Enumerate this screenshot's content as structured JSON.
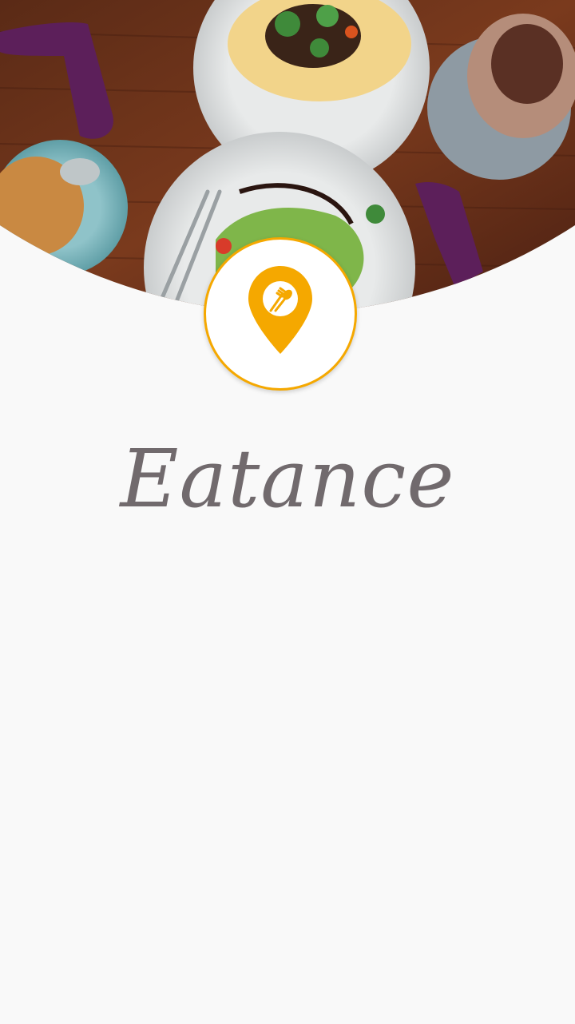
{
  "app": {
    "name": "Eatance"
  },
  "icons": {
    "hero": "food-table-photo",
    "logo": "location-pin-fork-spoon-icon"
  },
  "colors": {
    "accent": "#f5a800",
    "background": "#f9f9f9",
    "title": "#716a6d"
  }
}
